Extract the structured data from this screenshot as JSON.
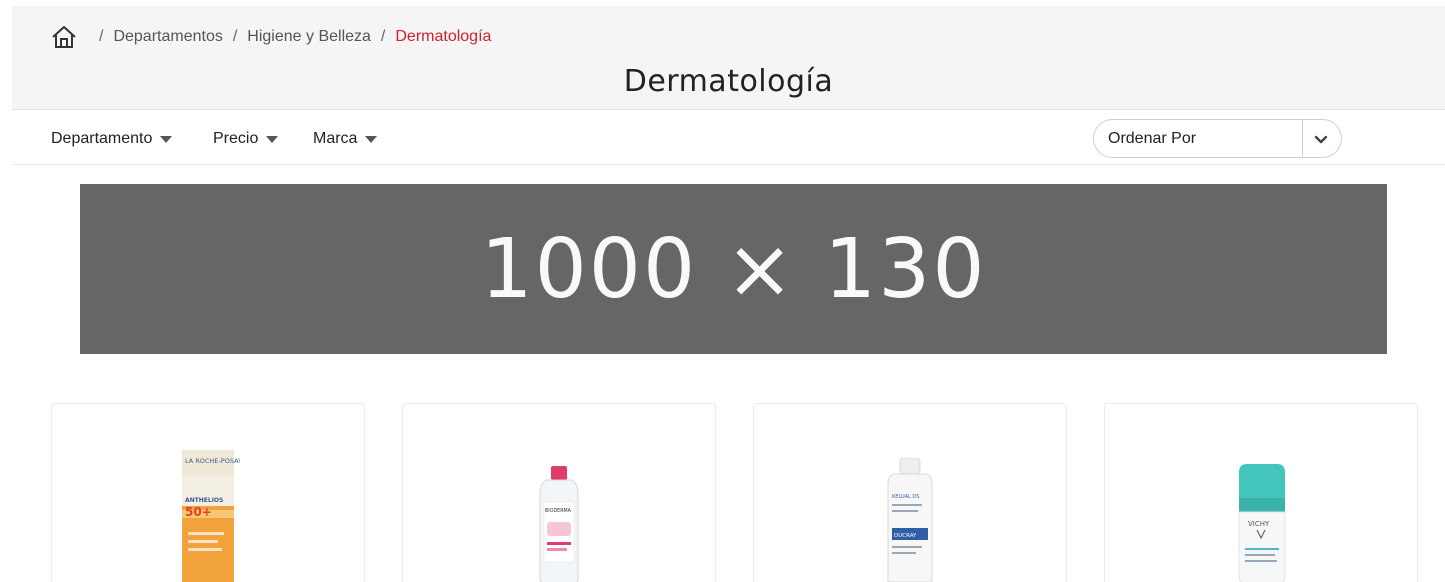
{
  "breadcrumb": {
    "home_icon": "home-icon",
    "items": [
      "Departamentos",
      "Higiene y Belleza"
    ],
    "current": "Dermatología",
    "separator": "/"
  },
  "page": {
    "title": "Dermatología"
  },
  "filters": {
    "department": "Departamento",
    "price": "Precio",
    "brand": "Marca"
  },
  "sort": {
    "label": "Ordenar Por",
    "icon": "chevron-down-icon"
  },
  "banner": {
    "text": "1000 × 130",
    "color": "#666666"
  },
  "products": [
    {
      "icon": "sunscreen-tube-image",
      "brand_text": "LA ROCHE-POSAY",
      "spf_text": "50+",
      "line_text": "ANTHELIOS"
    },
    {
      "icon": "micellar-water-bottle-image",
      "brand_text": "BIODERMA"
    },
    {
      "icon": "shampoo-bottle-image",
      "brand_text": "KELUAL DS",
      "line_text": "DUCRAY"
    },
    {
      "icon": "roll-on-deodorant-image",
      "brand_text": "VICHY"
    }
  ],
  "colors": {
    "accent": "#d0202e",
    "header_bg": "#f5f5f5",
    "border": "#e6e6e6"
  }
}
